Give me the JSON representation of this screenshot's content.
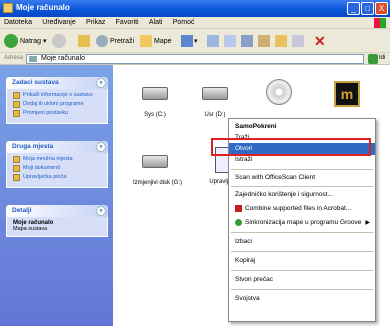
{
  "window": {
    "title": "Moje računalo"
  },
  "title_buttons": {
    "minimize": "_",
    "maximize": "□",
    "close": "X"
  },
  "menubar": [
    "Datoteka",
    "Uređivanje",
    "Prikaz",
    "Favoriti",
    "Alati",
    "Pomoć"
  ],
  "toolbar": {
    "back": "Natrag",
    "search": "Pretraži",
    "folders": "Mape"
  },
  "address": {
    "label": "Adresa",
    "value": "Moje računalo",
    "go": "Idi"
  },
  "left_panels": [
    {
      "title": "Zadaci sustava",
      "items": [
        "Prikaži informacije o sustavu",
        "Dodaj ili ukloni programe",
        "Promjeni postavku"
      ]
    },
    {
      "title": "Druga mjesta",
      "items": [
        "Moja mrežna mjesta",
        "Moji dokumenti",
        "Upravljačka ploča"
      ]
    },
    {
      "title": "Detalji",
      "detail_title": "Moje računalo",
      "detail_sub": "Mapa sustava"
    }
  ],
  "drives": [
    {
      "label": "Sys (C:)"
    },
    {
      "label": "Usr (D:)"
    },
    {
      "label": ""
    },
    {
      "label": ""
    },
    {
      "label": ""
    },
    {
      "label": "Izmjenjivi disk (G:)"
    },
    {
      "label": "Upravljačka"
    }
  ],
  "context_menu": {
    "items": [
      {
        "label": "SamoPokreni",
        "bold": true
      },
      {
        "label": "Traži"
      },
      {
        "label": "Otvori",
        "highlighted": true
      },
      {
        "label": "Istraži"
      },
      {
        "label": "Scan with OfficeScan Client"
      },
      {
        "label": "Zajedničko korištenje i sigurnost..."
      },
      {
        "label": "Combine supported files in Acrobat..."
      },
      {
        "label": "Sinkronizacija mape u programu Groove",
        "submenu": true
      },
      {
        "label": "Izbaci"
      },
      {
        "label": "Kopiraj"
      },
      {
        "label": "Stvori prečac"
      },
      {
        "label": "Svojstva"
      }
    ]
  },
  "colors": {
    "highlight": "#316ac5",
    "callout": "#e02020",
    "taskpane": "#7ba2e7"
  }
}
